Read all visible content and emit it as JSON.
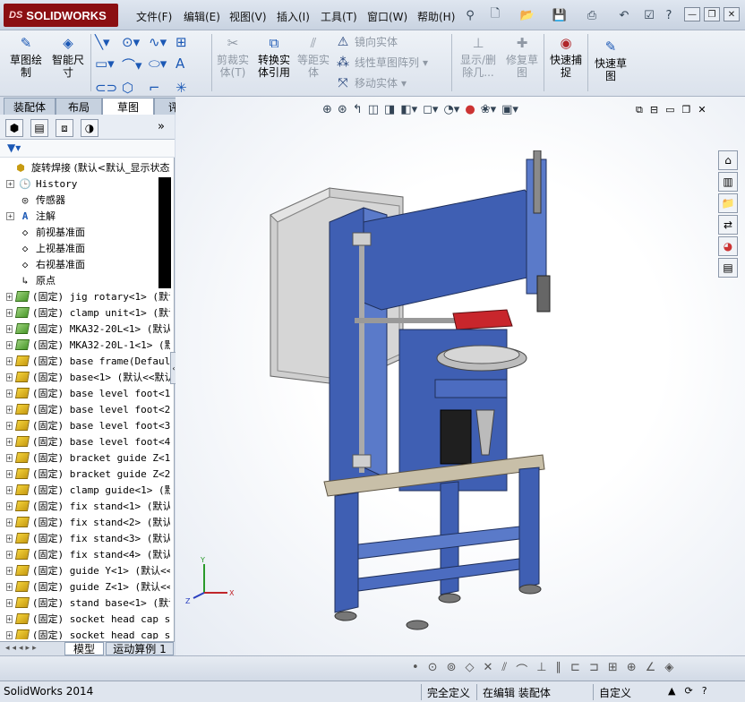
{
  "app": {
    "logo_text": "SOLIDWORKS",
    "logo_prefix": "DS"
  },
  "menu": [
    "文件(F)",
    "编辑(E)",
    "视图(V)",
    "插入(I)",
    "工具(T)",
    "窗口(W)",
    "帮助(H)"
  ],
  "ribbon": {
    "sketch": "草图绘\n制",
    "smart_dim": "智能尺\n寸",
    "trim": "剪裁实\n体(T)",
    "convert": "转换实\n体引用",
    "offset": "等距实\n体",
    "mirror": "镜向实体",
    "linear_pattern": "线性草图阵列",
    "move": "移动实体",
    "show_delete": "显示/删\n除几...",
    "repair": "修复草\n图",
    "quick_snap": "快速捕\n捉",
    "rapid_sketch": "快速草\n图"
  },
  "tabs": [
    "装配体",
    "布局",
    "草图",
    "评估"
  ],
  "active_tab": "草图",
  "tree": [
    {
      "text": "旋转焊接  (默认<默认_显示状态",
      "icon": "asm",
      "exp": "none",
      "label_only": true
    },
    {
      "text": "History",
      "icon": "history",
      "exp": "plus"
    },
    {
      "text": "传感器",
      "icon": "sensor",
      "exp": "none"
    },
    {
      "text": "注解",
      "icon": "annot",
      "exp": "plus"
    },
    {
      "text": "前视基准面",
      "icon": "plane",
      "exp": "none"
    },
    {
      "text": "上视基准面",
      "icon": "plane",
      "exp": "none"
    },
    {
      "text": "右视基准面",
      "icon": "plane",
      "exp": "none"
    },
    {
      "text": "原点",
      "icon": "origin",
      "exp": "none"
    },
    {
      "text": "(固定) jig rotary<1> (默认",
      "icon": "partg",
      "exp": "plus"
    },
    {
      "text": "(固定) clamp unit<1> (默认",
      "icon": "partg",
      "exp": "plus"
    },
    {
      "text": "(固定) MKA32-20L<1> (默认",
      "icon": "partg",
      "exp": "plus"
    },
    {
      "text": "(固定) MKA32-20L-1<1> (默",
      "icon": "partg",
      "exp": "plus"
    },
    {
      "text": "(固定) base frame(Default",
      "icon": "part",
      "exp": "plus"
    },
    {
      "text": "(固定) base<1> (默认<<默认",
      "icon": "part",
      "exp": "plus"
    },
    {
      "text": "(固定) base level foot<1>",
      "icon": "part",
      "exp": "plus"
    },
    {
      "text": "(固定) base level foot<2>",
      "icon": "part",
      "exp": "plus"
    },
    {
      "text": "(固定) base level foot<3>",
      "icon": "part",
      "exp": "plus"
    },
    {
      "text": "(固定) base level foot<4>",
      "icon": "part",
      "exp": "plus"
    },
    {
      "text": "(固定) bracket guide Z<1>",
      "icon": "part",
      "exp": "plus"
    },
    {
      "text": "(固定) bracket guide Z<2>",
      "icon": "part",
      "exp": "plus"
    },
    {
      "text": "(固定) clamp guide<1> (默",
      "icon": "part",
      "exp": "plus"
    },
    {
      "text": "(固定) fix stand<1> (默认",
      "icon": "part",
      "exp": "plus"
    },
    {
      "text": "(固定) fix stand<2> (默认",
      "icon": "part",
      "exp": "plus"
    },
    {
      "text": "(固定) fix stand<3> (默认",
      "icon": "part",
      "exp": "plus"
    },
    {
      "text": "(固定) fix stand<4> (默认",
      "icon": "part",
      "exp": "plus"
    },
    {
      "text": "(固定) guide Y<1> (默认<<",
      "icon": "part",
      "exp": "plus"
    },
    {
      "text": "(固定) guide Z<1> (默认<<",
      "icon": "part",
      "exp": "plus"
    },
    {
      "text": "(固定) stand base<1> (默认",
      "icon": "part",
      "exp": "plus"
    },
    {
      "text": "(固定) socket head cap sc",
      "icon": "part",
      "exp": "plus"
    },
    {
      "text": "(固定) socket head cap sc",
      "icon": "part",
      "exp": "plus"
    }
  ],
  "bottom_tabs": [
    "模型",
    "运动算例 1"
  ],
  "status": {
    "app_version": "SolidWorks 2014",
    "definition": "完全定义",
    "editing": "在编辑 装配体",
    "units": "自定义"
  },
  "colors": {
    "accent": "#8b0f12",
    "frame_blue": "#3c5cad",
    "panel_bg": "#ffffff"
  }
}
